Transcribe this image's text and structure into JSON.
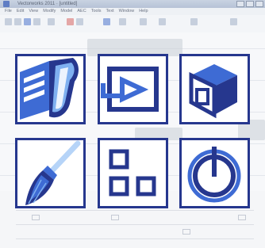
{
  "window": {
    "title": "Vectorworks 2011 · [untitled]"
  },
  "menu": [
    "File",
    "Edit",
    "View",
    "Modify",
    "Model",
    "AEC",
    "Tools",
    "Text",
    "Window",
    "Help"
  ],
  "tiles": [
    {
      "icon": "document-pages-icon"
    },
    {
      "icon": "presentation-play-icon"
    },
    {
      "icon": "3d-cube-icon"
    },
    {
      "icon": "paint-brush-icon"
    },
    {
      "icon": "layout-grid-icon"
    },
    {
      "icon": "timer-dial-icon"
    }
  ],
  "colors": {
    "tile_border": "#26378e",
    "icon_dark": "#26378e",
    "icon_mid": "#3e6bd4",
    "icon_light": "#7fb0f0",
    "background": "#e9ecf1"
  }
}
